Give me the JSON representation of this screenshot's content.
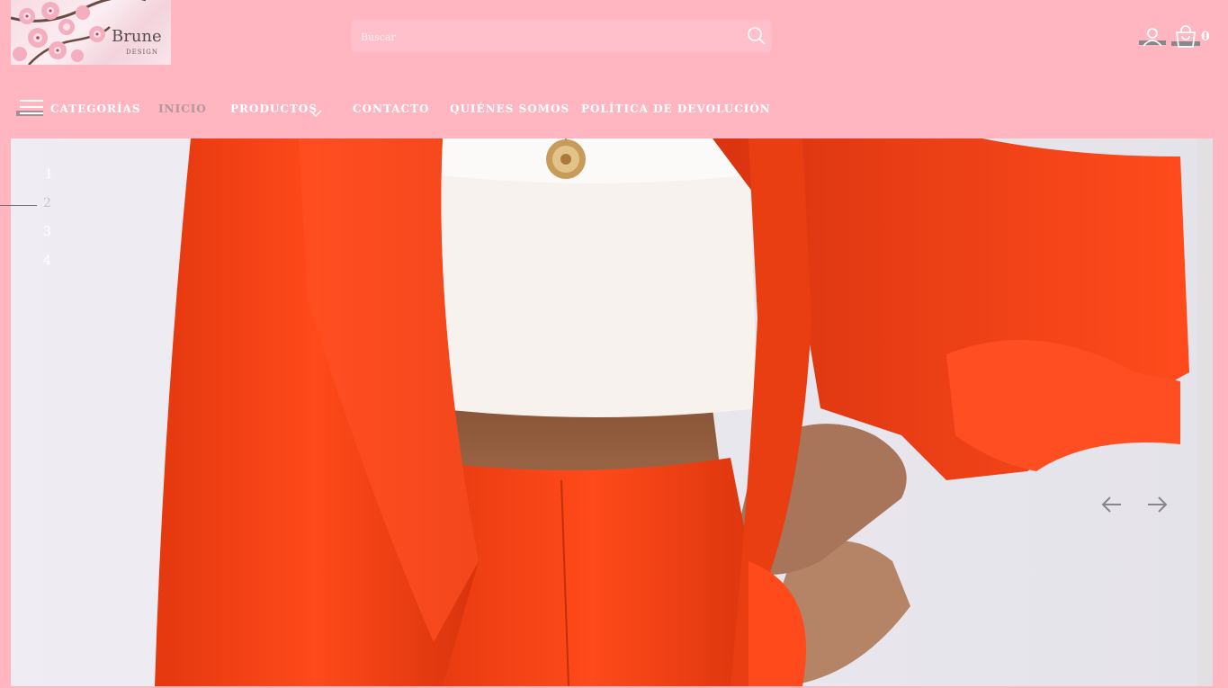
{
  "header": {
    "logo": {
      "name": "Brune",
      "tagline": "DESIGN"
    },
    "search": {
      "placeholder": "Buscar",
      "value": ""
    },
    "cart": {
      "count": "0"
    }
  },
  "nav": {
    "items": [
      {
        "label": "CATEGORÍAS"
      },
      {
        "label": "INICIO"
      },
      {
        "label": "PRODUCTOS"
      },
      {
        "label": "CONTACTO"
      },
      {
        "label": "QUIÉNES SOMOS"
      },
      {
        "label": "POLÍTICA DE DEVOLUCIÓN"
      }
    ]
  },
  "slider": {
    "pages": [
      "1",
      "2",
      "3",
      "4"
    ],
    "active_page": "2"
  },
  "colors": {
    "header_bg": "#ffb6c1",
    "search_bg": "#ffc0cb",
    "nav_text": "#ffffff",
    "nav_active": "#b0989c"
  }
}
